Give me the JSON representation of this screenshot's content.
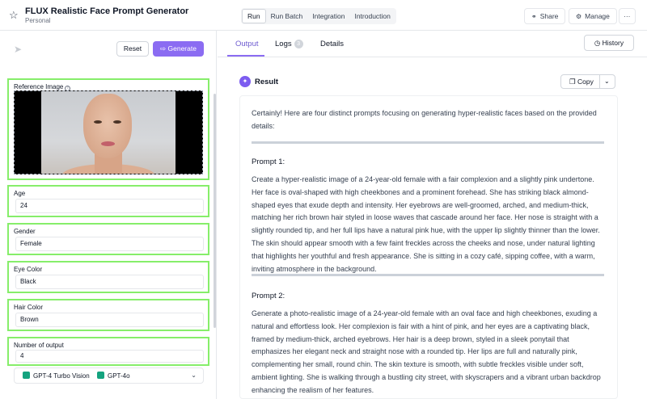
{
  "header": {
    "app_title": "FLUX Realistic Face Prompt Generator",
    "workspace": "Personal",
    "mode_tabs": [
      "Run",
      "Run Batch",
      "Integration",
      "Introduction"
    ],
    "active_mode": "Run",
    "share_label": "Share",
    "manage_label": "Manage",
    "more_label": "···",
    "icons": {
      "star": "star-icon",
      "share": "share-icon",
      "manage": "gear-icon"
    }
  },
  "left": {
    "reset_label": "Reset",
    "generate_label": "Generate",
    "generate_color": "#8b6cf2",
    "highlight_color": "#86ee6a",
    "reference_label": "Reference Image",
    "fields": [
      {
        "label": "Age",
        "value": "24"
      },
      {
        "label": "Gender",
        "value": "Female"
      },
      {
        "label": "Eye Color",
        "value": "Black"
      },
      {
        "label": "Hair Color",
        "value": "Brown"
      },
      {
        "label": "Number of output",
        "value": "4"
      }
    ],
    "models": [
      "GPT-4 Turbo Vision",
      "GPT-4o"
    ]
  },
  "right": {
    "tabs": [
      "Output",
      "Logs",
      "Details"
    ],
    "active_tab": "Output",
    "logs_count": "3",
    "history_label": "History",
    "result_title": "Result",
    "copy_label": "Copy",
    "intro": "Certainly! Here are four distinct prompts focusing on generating hyper-realistic faces based on the provided details:",
    "prompts": [
      {
        "title": "Prompt 1:",
        "text": "Create a hyper-realistic image of a 24-year-old female with a fair complexion and a slightly pink undertone. Her face is oval-shaped with high cheekbones and a prominent forehead. She has striking black almond-shaped eyes that exude depth and intensity. Her eyebrows are well-groomed, arched, and medium-thick, matching her rich brown hair styled in loose waves that cascade around her face. Her nose is straight with a slightly rounded tip, and her full lips have a natural pink hue, with the upper lip slightly thinner than the lower. The skin should appear smooth with a few faint freckles across the cheeks and nose, under natural lighting that highlights her youthful and fresh appearance. She is sitting in a cozy café, sipping coffee, with a warm, inviting atmosphere in the background."
      },
      {
        "title": "Prompt 2:",
        "text": "Generate a photo-realistic image of a 24-year-old female with an oval face and high cheekbones, exuding a natural and effortless look. Her complexion is fair with a hint of pink, and her eyes are a captivating black, framed by medium-thick, arched eyebrows. Her hair is a deep brown, styled in a sleek ponytail that emphasizes her elegant neck and straight nose with a rounded tip. Her lips are full and naturally pink, complementing her small, round chin. The skin texture is smooth, with subtle freckles visible under soft, ambient lighting. She is walking through a bustling city street, with skyscrapers and a vibrant urban backdrop enhancing the realism of her features."
      }
    ]
  }
}
